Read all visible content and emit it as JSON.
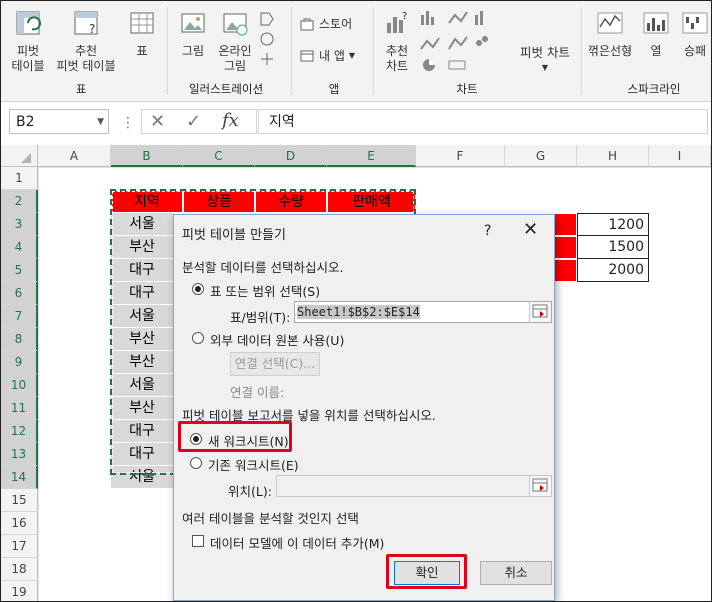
{
  "ribbon": {
    "groups": [
      {
        "label": "표",
        "buttons": [
          "피벗\n테이블",
          "추천\n피벗 테이블",
          "표"
        ]
      },
      {
        "label": "일러스트레이션",
        "buttons": [
          "그림",
          "온라인\n그림"
        ]
      },
      {
        "label": "앱",
        "buttons": [
          "스토어",
          "내 앱"
        ]
      },
      {
        "label": "차트",
        "buttons": [
          "추천\n차트",
          "피벗 차트"
        ]
      },
      {
        "label": "스파크라인",
        "buttons": [
          "꺾은선형",
          "열",
          "승패"
        ]
      }
    ]
  },
  "formula_bar": {
    "name_box": "B2",
    "formula": "지역"
  },
  "sheet": {
    "columns": [
      "A",
      "B",
      "C",
      "D",
      "E",
      "F",
      "G",
      "H",
      "I"
    ],
    "rows": [
      "1",
      "2",
      "3",
      "4",
      "5",
      "6",
      "7",
      "8",
      "9",
      "10",
      "11",
      "12",
      "13",
      "14",
      "15",
      "16",
      "17",
      "18",
      "19"
    ],
    "headers": [
      "지역",
      "상품",
      "수량",
      "판매액"
    ],
    "regions": [
      "서울",
      "부산",
      "대구",
      "대구",
      "서울",
      "부산",
      "부산",
      "서울",
      "부산",
      "대구",
      "대구",
      "서울"
    ],
    "h_values": [
      "1200",
      "1500",
      "2000"
    ]
  },
  "dialog": {
    "title": "피벗 테이블 만들기",
    "help": "?",
    "close": "✕",
    "section1": "분석할 데이터를 선택하십시오.",
    "opt_table": "표 또는 범위 선택(S)",
    "range_label": "표/범위(T):",
    "range_value": "Sheet1!$B$2:$E$14",
    "opt_external": "외부 데이터 원본 사용(U)",
    "choose_conn": "연결 선택(C)...",
    "conn_name": "연결 이름:",
    "section2": "피벗 테이블 보고서를 넣을 위치를 선택하십시오.",
    "opt_new": "새 워크시트(N)",
    "opt_existing": "기존 워크시트(E)",
    "location_label": "위치(L):",
    "section3": "여러 테이블을 분석할 것인지 선택",
    "data_model": "데이터 모델에 이 데이터 추가(M)",
    "ok": "확인",
    "cancel": "취소"
  },
  "colors": {
    "accent": "#217346",
    "header_red": "#ff0000",
    "highlight": "#e0001b"
  }
}
